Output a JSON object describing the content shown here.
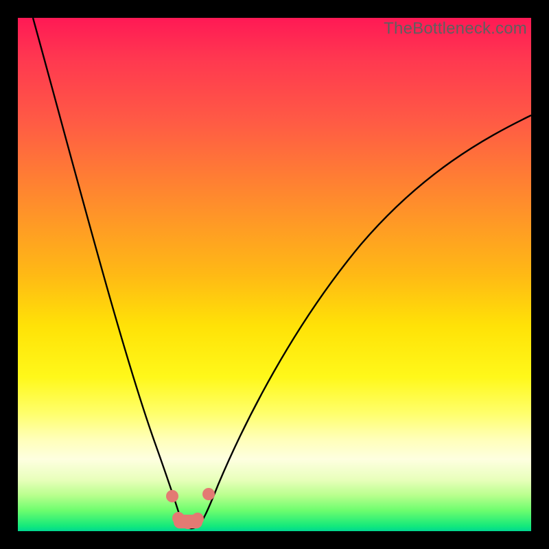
{
  "watermark": "TheBottleneck.com",
  "chart_data": {
    "type": "line",
    "title": "",
    "xlabel": "",
    "ylabel": "",
    "xlim": [
      0,
      100
    ],
    "ylim": [
      0,
      100
    ],
    "series": [
      {
        "name": "left-branch",
        "x": [
          3,
          6,
          9,
          12,
          15,
          18,
          21,
          24,
          26,
          28,
          29.5,
          30.2
        ],
        "values": [
          100,
          88,
          76,
          64,
          52,
          40,
          28,
          17,
          10,
          5,
          2,
          1
        ]
      },
      {
        "name": "right-branch",
        "x": [
          33.2,
          34.5,
          37,
          41,
          46,
          52,
          59,
          67,
          76,
          86,
          97,
          100
        ],
        "values": [
          1,
          3,
          10,
          22,
          35,
          47,
          57,
          65,
          71,
          76,
          80,
          81
        ]
      }
    ],
    "markers": [
      {
        "name": "left-upper-dot",
        "x": 28.2,
        "y": 6.0
      },
      {
        "name": "right-upper-dot",
        "x": 35.2,
        "y": 6.5
      },
      {
        "name": "bottom-left-dot",
        "x": 29.8,
        "y": 1.8
      },
      {
        "name": "bottom-mid-dot",
        "x": 31.5,
        "y": 0.9
      },
      {
        "name": "bottom-right-dot",
        "x": 33.4,
        "y": 1.6
      }
    ]
  }
}
